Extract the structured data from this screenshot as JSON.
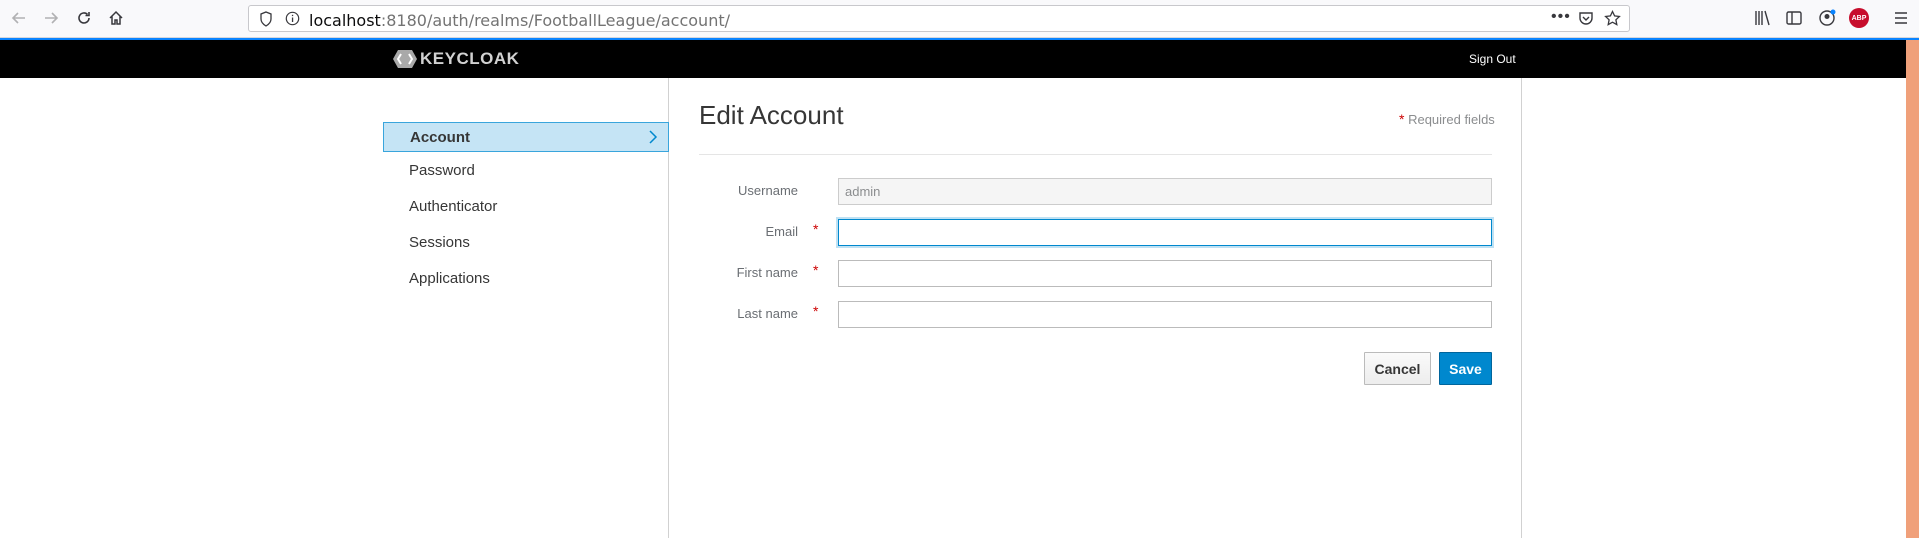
{
  "browser": {
    "url_host": "localhost",
    "url_path": ":8180/auth/realms/FootballLeague/account/",
    "adblock_badge": "ABP"
  },
  "header": {
    "logo_text": "KEYCLOAK",
    "sign_out": "Sign Out"
  },
  "sidebar": {
    "items": [
      {
        "label": "Account",
        "active": true
      },
      {
        "label": "Password"
      },
      {
        "label": "Authenticator"
      },
      {
        "label": "Sessions"
      },
      {
        "label": "Applications"
      }
    ]
  },
  "form": {
    "title": "Edit Account",
    "required_star": "*",
    "required_note": "Required fields",
    "fields": [
      {
        "label": "Username",
        "value": "admin",
        "required": false,
        "disabled": true
      },
      {
        "label": "Email",
        "value": "",
        "required": true,
        "focused": true
      },
      {
        "label": "First name",
        "value": "",
        "required": true
      },
      {
        "label": "Last name",
        "value": "",
        "required": true
      }
    ],
    "cancel_label": "Cancel",
    "save_label": "Save"
  },
  "colors": {
    "header_bg": "#000000",
    "active_nav_bg": "#c5e4f5",
    "primary": "#0088ce",
    "required": "#cc0000"
  }
}
